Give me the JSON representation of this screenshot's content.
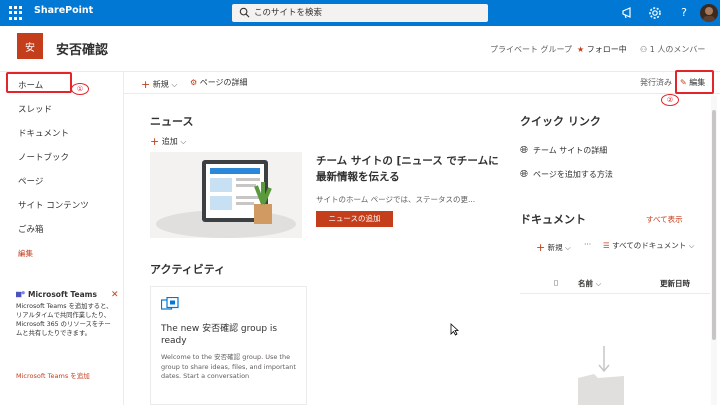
{
  "suite": {
    "brand": "SharePoint",
    "search_placeholder": "このサイトを検索"
  },
  "site": {
    "logo_letter": "安",
    "title": "安否確認",
    "privacy": "プライベート グループ",
    "follow": "フォロー中",
    "members": "1 人のメンバー"
  },
  "nav": {
    "items": [
      {
        "label": "ホーム"
      },
      {
        "label": "スレッド"
      },
      {
        "label": "ドキュメント"
      },
      {
        "label": "ノートブック"
      },
      {
        "label": "ページ"
      },
      {
        "label": "サイト コンテンツ"
      },
      {
        "label": "ごみ箱"
      }
    ],
    "edit": "編集"
  },
  "annotations": {
    "step1": "①",
    "step2": "②"
  },
  "teams": {
    "title": "Microsoft Teams",
    "body": "Microsoft Teams を追加すると、リアルタイムで共同作業したり、Microsoft 365 のリソースをチームと共有したりできます。",
    "link": "Microsoft Teams を追加"
  },
  "commandbar": {
    "new": "新規",
    "page_details": "ページの詳細",
    "published": "発行済み",
    "edit": "編集"
  },
  "news": {
    "title": "ニュース",
    "add": "追加",
    "heading": "チーム サイトの [ニュース でチームに最新情報を伝える",
    "desc": "サイトのホーム ページでは、ステータスの更...",
    "button": "ニュースの追加"
  },
  "activity": {
    "title": "アクティビティ",
    "card_title": "The new 安否確認 group is ready",
    "card_desc": "Welcome to the 安否確認 group. Use the group to share ideas, files, and important dates. Start a conversation"
  },
  "quicklinks": {
    "title": "クイック リンク",
    "items": [
      {
        "label": "チーム サイトの詳細"
      },
      {
        "label": "ページを追加する方法"
      }
    ]
  },
  "documents": {
    "title": "ドキュメント",
    "show_all": "すべて表示",
    "new": "新規",
    "more": "···",
    "all_docs": "すべてのドキュメント",
    "col_name": "名前",
    "col_modified": "更新日時"
  },
  "colors": {
    "suite_blue": "#0078d4",
    "accent": "#c43e1c",
    "annotation_red": "#e3242b"
  }
}
